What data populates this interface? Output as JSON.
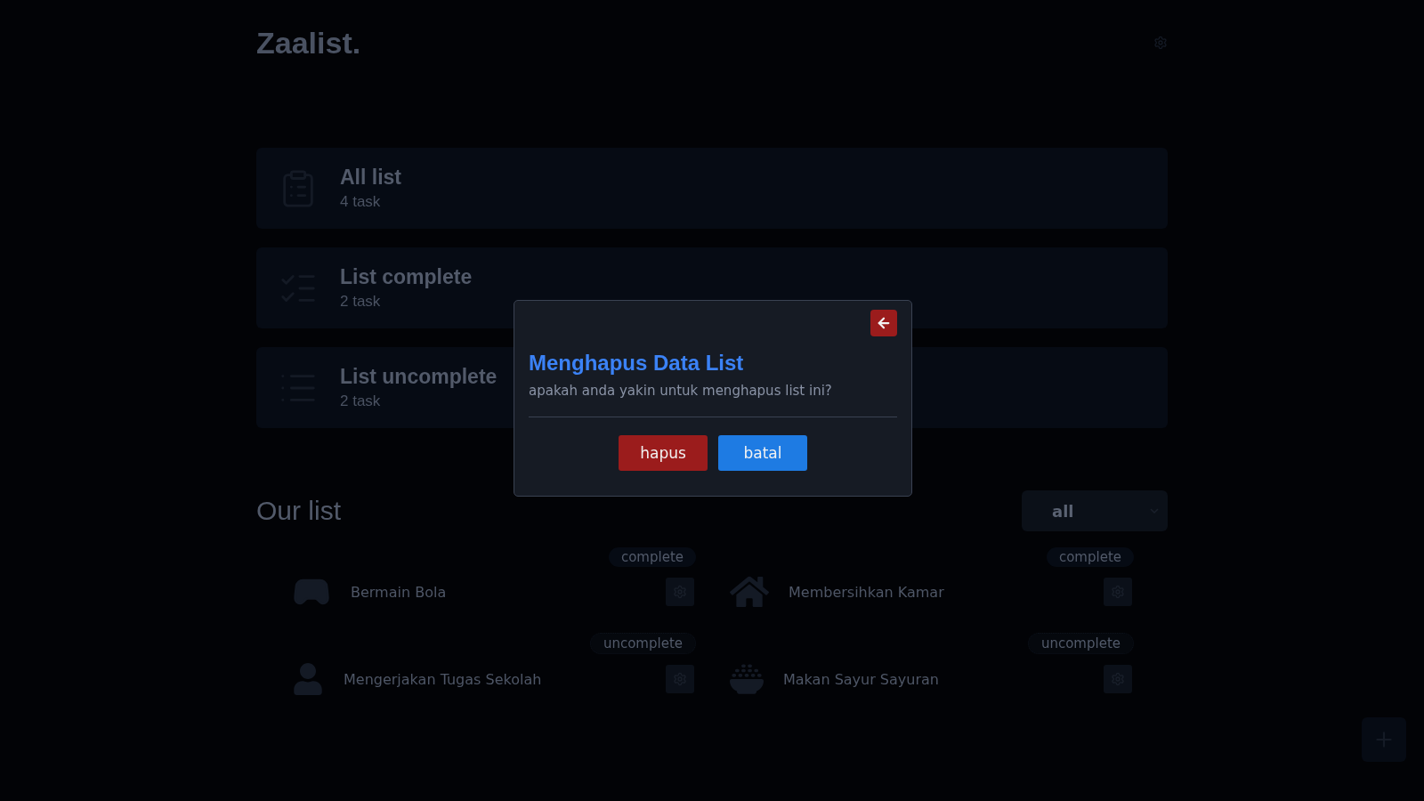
{
  "app": {
    "title": "Zaalist."
  },
  "summary_cards": [
    {
      "kind": "all",
      "title": "All list",
      "count": "4 task"
    },
    {
      "kind": "complete",
      "title": "List complete",
      "count": "2 task"
    },
    {
      "kind": "uncomplete",
      "title": "List uncomplete",
      "count": "2 task"
    }
  ],
  "list_section": {
    "title": "Our list",
    "filter": {
      "value": "all"
    }
  },
  "tasks": [
    {
      "kind": "game",
      "name": "Bermain Bola",
      "status": "complete"
    },
    {
      "kind": "chore",
      "name": "Membersihkan Kamar",
      "status": "complete"
    },
    {
      "kind": "study",
      "name": "Mengerjakan Tugas Sekolah",
      "status": "uncomplete"
    },
    {
      "kind": "meal",
      "name": "Makan Sayur Sayuran",
      "status": "uncomplete"
    }
  ],
  "dialog": {
    "title": "Menghapus Data List",
    "message": "apakah anda yakin untuk menghapus list ini?",
    "buttons": [
      {
        "kind": "danger",
        "label": "hapus"
      },
      {
        "kind": "primary",
        "label": "batal"
      }
    ]
  }
}
